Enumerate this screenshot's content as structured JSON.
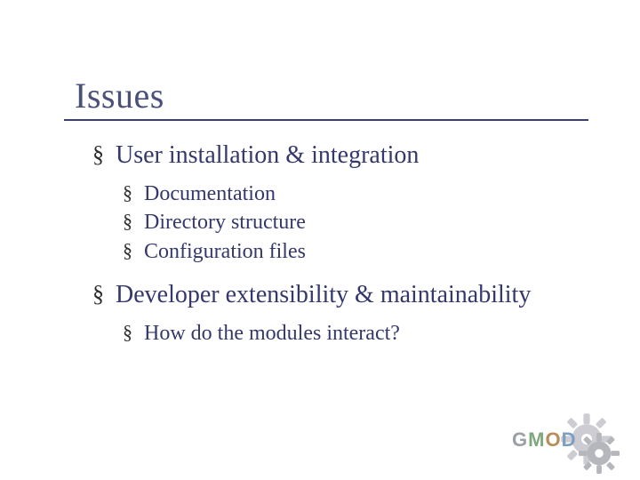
{
  "title": "Issues",
  "bullets": {
    "b1": "User installation & integration",
    "b1_subs": {
      "s1": "Documentation",
      "s2": "Directory structure",
      "s3": "Configuration files"
    },
    "b2": "Developer extensibility & maintainability",
    "b2_subs": {
      "s1": "How do the modules interact?"
    }
  },
  "logo": {
    "g": "G",
    "m": "M",
    "o": "O",
    "d": "D"
  }
}
